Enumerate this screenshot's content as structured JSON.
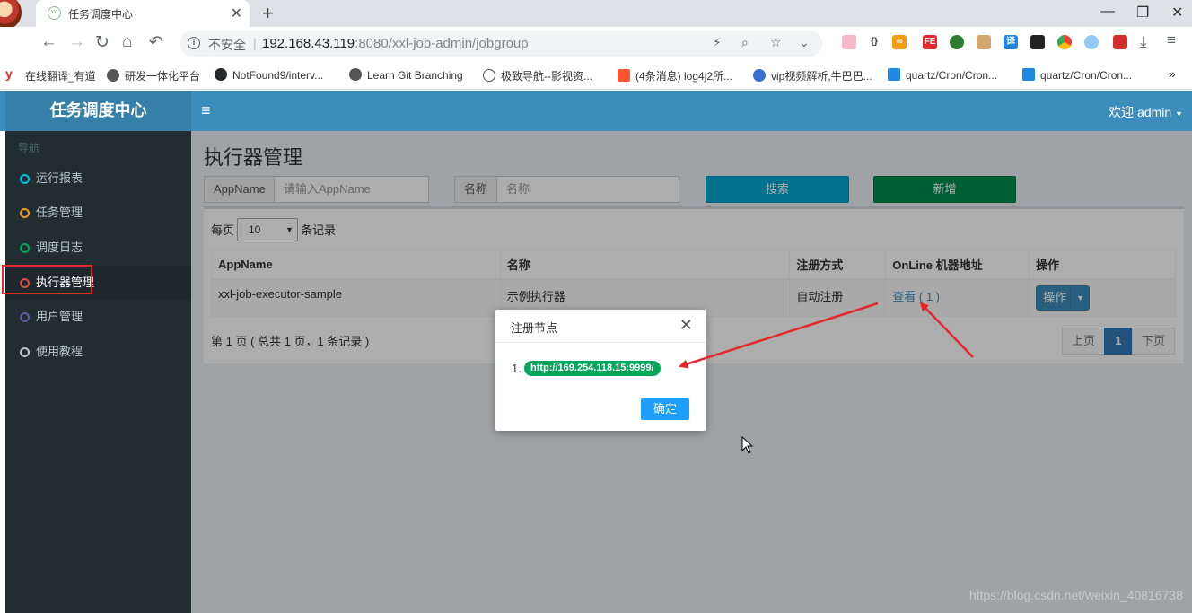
{
  "browser": {
    "tab_title": "任务调度中心",
    "tab_favicon": "xxl",
    "address": {
      "security_label": "不安全",
      "host": "192.168.43.119",
      "path": ":8080/xxl-job-admin/jobgroup"
    },
    "bookmarks": [
      {
        "label": "在线翻译_有道",
        "icon": "youdao-icon",
        "color": "#e5262a"
      },
      {
        "label": "研发一体化平台",
        "icon": "globe-icon",
        "color": "#555555"
      },
      {
        "label": "NotFound9/interv...",
        "icon": "github-icon",
        "color": "#24292e"
      },
      {
        "label": "Learn Git Branching",
        "icon": "globe-icon",
        "color": "#555555"
      },
      {
        "label": "极致导航--影视资...",
        "icon": "leaf-icon",
        "color": "#555555"
      },
      {
        "label": "(4条消息) log4j2所...",
        "icon": "csdn-icon",
        "color": "#fc5531"
      },
      {
        "label": "vip视频解析,牛巴巴...",
        "icon": "rocket-icon",
        "color": "#3b6ed3"
      },
      {
        "label": "quartz/Cron/Cron...",
        "icon": "bilibili-icon",
        "color": "#1e88e5"
      },
      {
        "label": "quartz/Cron/Cron...",
        "icon": "bilibili-icon",
        "color": "#1e88e5"
      }
    ],
    "bookmarks_more": "»"
  },
  "app": {
    "logo": "任务调度中心",
    "welcome": "欢迎 admin",
    "nav_header": "导航",
    "nav_items": [
      {
        "label": "运行报表",
        "dot_color": "#00c0ef"
      },
      {
        "label": "任务管理",
        "dot_color": "#f39c12"
      },
      {
        "label": "调度日志",
        "dot_color": "#00a65a"
      },
      {
        "label": "执行器管理",
        "dot_color": "#dd4b39"
      },
      {
        "label": "用户管理",
        "dot_color": "#605ca8"
      },
      {
        "label": "使用教程",
        "dot_color": "#b8c7ce"
      }
    ],
    "active_nav_index": 3
  },
  "page": {
    "title": "执行器管理",
    "filters": {
      "appname_label": "AppName",
      "appname_placeholder": "请输入AppName",
      "name_label": "名称",
      "name_placeholder": "名称",
      "search_button": "搜索",
      "add_button": "新增"
    },
    "length": {
      "prefix": "每页",
      "value": "10",
      "suffix": "条记录"
    },
    "table": {
      "headers": [
        "AppName",
        "名称",
        "注册方式",
        "OnLine 机器地址",
        "操作"
      ],
      "rows": [
        {
          "appname": "xxl-job-executor-sample",
          "name": "示例执行器",
          "register_type": "自动注册",
          "online_link": "查看",
          "online_count": "( 1 )",
          "action": "操作"
        }
      ]
    },
    "info": "第 1 页 ( 总共 1 页，1 条记录 )",
    "pagination": {
      "prev": "上页",
      "current": "1",
      "next": "下页"
    }
  },
  "modal": {
    "title": "注册节点",
    "item_number": "1.",
    "address": "http://169.254.118.15:9999/",
    "confirm": "确定"
  },
  "colors": {
    "header": "#3c8dbc",
    "sidebar": "#222d32",
    "search_button": "#00a7d0",
    "add_button": "#008d4c",
    "badge": "#00a65a",
    "annotation_red": "#e5262a"
  },
  "watermark": "https://blog.csdn.net/weixin_40816738"
}
